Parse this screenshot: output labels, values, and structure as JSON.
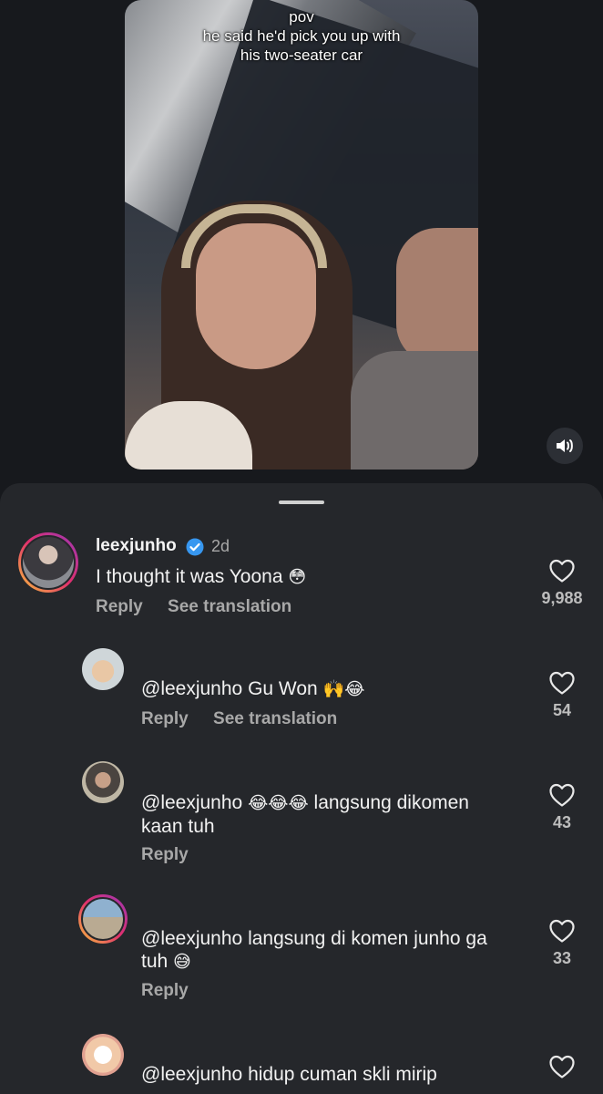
{
  "video": {
    "caption_lines": [
      "pov",
      "he said he'd pick you up with",
      "his two-seater car"
    ]
  },
  "comments": [
    {
      "username": "leexjunho",
      "time": "2d",
      "text": "I thought it was Yoona",
      "emoji": "😳",
      "reply": "Reply",
      "translate": "See translation",
      "likes": "9,988"
    },
    {
      "mention": "@leexjunho",
      "text": "Gu Won",
      "emoji": "🙌😂",
      "reply": "Reply",
      "translate": "See translation",
      "likes": "54"
    },
    {
      "mention": "@leexjunho",
      "emoji": "😂😂😂",
      "text": "langsung dikomen",
      "text2": "kaan tuh",
      "reply": "Reply",
      "likes": "43"
    },
    {
      "mention": "@leexjunho",
      "text": "langsung di komen junho ga",
      "text2": "tuh",
      "emoji": "😅",
      "reply": "Reply",
      "likes": "33"
    },
    {
      "mention": "@leexjunho",
      "text": "hidup cuman skli mirip"
    }
  ],
  "icons": {
    "mute": "speaker-icon",
    "verified": "verified-badge-icon",
    "like": "heart-outline-icon"
  }
}
